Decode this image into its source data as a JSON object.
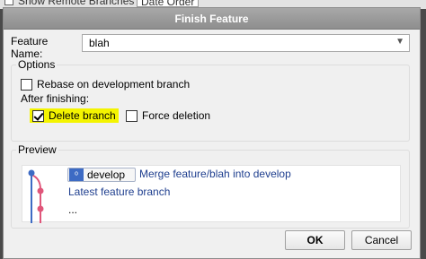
{
  "background": {
    "show_remote_label": "Show Remote Branches",
    "order_label": "Date Order"
  },
  "dialog": {
    "title": "Finish Feature",
    "feature_name_label": "Feature Name:",
    "feature_name_value": "blah",
    "options": {
      "title": "Options",
      "rebase_label": "Rebase on development branch",
      "rebase_checked": false,
      "after_finishing_label": "After finishing:",
      "delete_branch_label": "Delete branch",
      "delete_branch_checked": true,
      "force_deletion_label": "Force deletion",
      "force_deletion_checked": false
    },
    "preview": {
      "title": "Preview",
      "branch_chip": "develop",
      "merge_text": "Merge feature/blah into develop",
      "latest_text": "Latest feature branch",
      "ellipsis": "..."
    },
    "buttons": {
      "ok": "OK",
      "cancel": "Cancel"
    }
  },
  "colors": {
    "highlight": "#f4f400",
    "link_text": "#1f3f8f",
    "graph_blue": "#3d6bc4",
    "graph_pink": "#e0567a"
  },
  "icons": {
    "branch_chip_icon": "branch-icon",
    "combo_arrow": "chevron-down-icon",
    "checkbox_checked": "checkmark-icon"
  }
}
